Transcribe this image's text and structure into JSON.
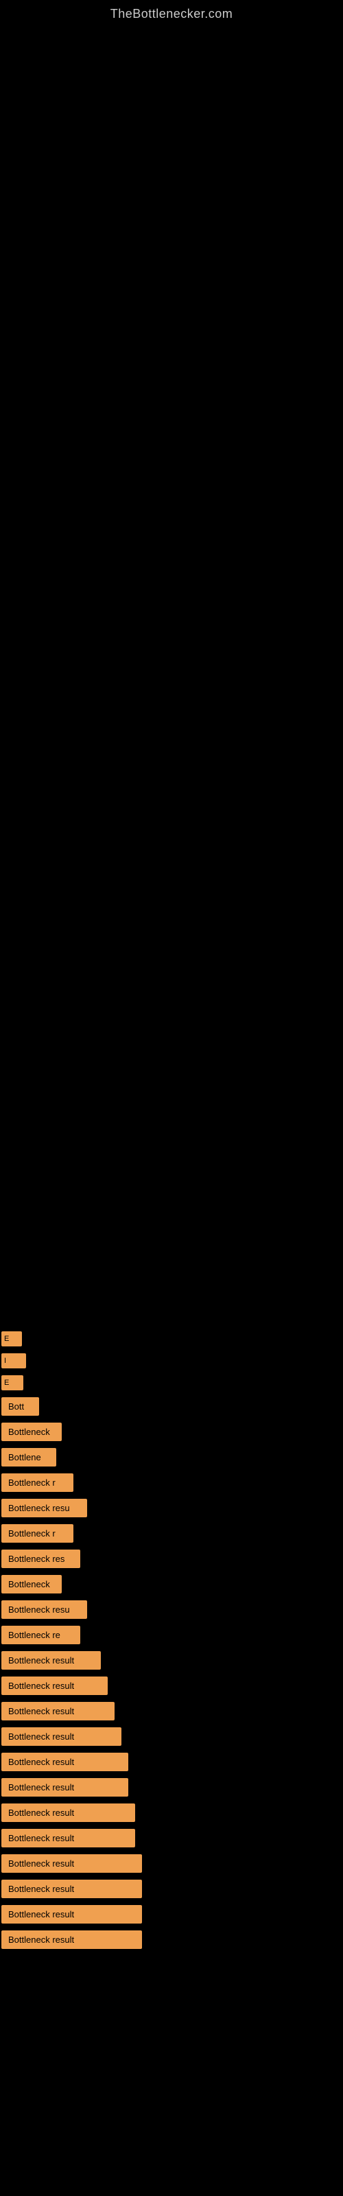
{
  "site": {
    "title": "TheBottlenecker.com"
  },
  "results": [
    {
      "label": "E",
      "class": "short1"
    },
    {
      "label": "I",
      "class": "short2"
    },
    {
      "label": "E",
      "class": "short3"
    },
    {
      "label": "Bott",
      "class": "w55"
    },
    {
      "label": "Bottleneck",
      "class": "w88"
    },
    {
      "label": "Bottlene",
      "class": "w80"
    },
    {
      "label": "Bottleneck r",
      "class": "w105"
    },
    {
      "label": "Bottleneck resu",
      "class": "w125"
    },
    {
      "label": "Bottleneck r",
      "class": "w105"
    },
    {
      "label": "Bottleneck res",
      "class": "w115"
    },
    {
      "label": "Bottleneck",
      "class": "w88"
    },
    {
      "label": "Bottleneck resu",
      "class": "w125"
    },
    {
      "label": "Bottleneck re",
      "class": "w115"
    },
    {
      "label": "Bottleneck result",
      "class": "w145"
    },
    {
      "label": "Bottleneck result",
      "class": "w155"
    },
    {
      "label": "Bottleneck result",
      "class": "w165"
    },
    {
      "label": "Bottleneck result",
      "class": "w175"
    },
    {
      "label": "Bottleneck result",
      "class": "w185"
    },
    {
      "label": "Bottleneck result",
      "class": "w185"
    },
    {
      "label": "Bottleneck result",
      "class": "w195"
    },
    {
      "label": "Bottleneck result",
      "class": "w195"
    },
    {
      "label": "Bottleneck result",
      "class": "w205"
    },
    {
      "label": "Bottleneck result",
      "class": "w205"
    },
    {
      "label": "Bottleneck result",
      "class": "w205"
    },
    {
      "label": "Bottleneck result",
      "class": "w205"
    }
  ]
}
